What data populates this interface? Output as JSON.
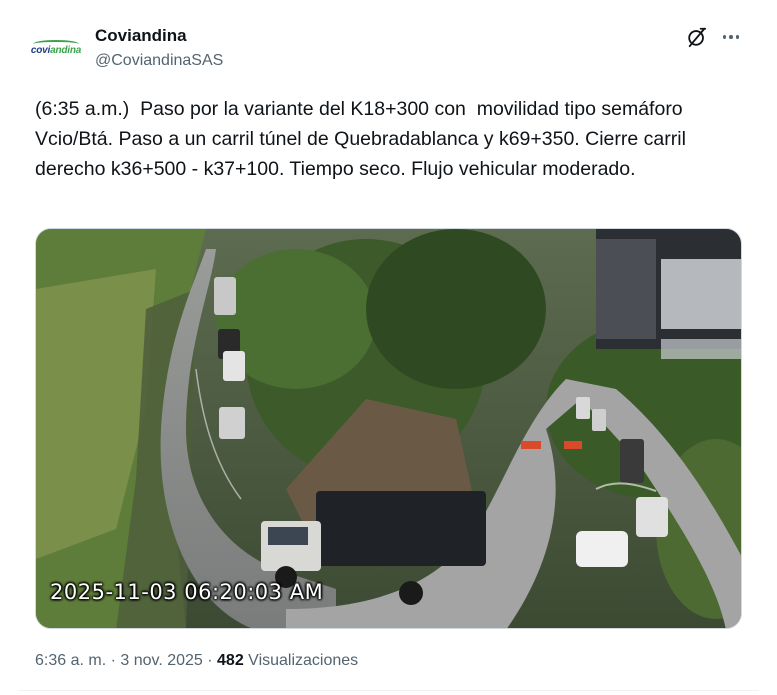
{
  "author": {
    "name": "Coviandina",
    "handle": "@CoviandinaSAS",
    "logo_text_a": "covi",
    "logo_text_b": "andina"
  },
  "post": {
    "text": "(6:35 a.m.)  Paso por la variante del K18+300 con  movilidad tipo semáforo Vcio/Btá. Paso a un carril túnel de Quebradablanca y k69+350. Cierre carril derecho k36+500 - k37+100. Tiempo seco. Flujo vehicular moderado.",
    "image_timestamp": "2025-11-03 06:20:03 AM"
  },
  "meta": {
    "time": "6:36 a. m.",
    "separator1": " · ",
    "date": "3 nov. 2025",
    "separator2": " · ",
    "views": "482",
    "views_label": " Visualizaciones"
  },
  "icons": {
    "grok": "grok-icon",
    "more": "more-options-icon"
  },
  "colors": {
    "text_primary": "#0f1419",
    "text_secondary": "#536471",
    "border": "#cfd9de"
  }
}
